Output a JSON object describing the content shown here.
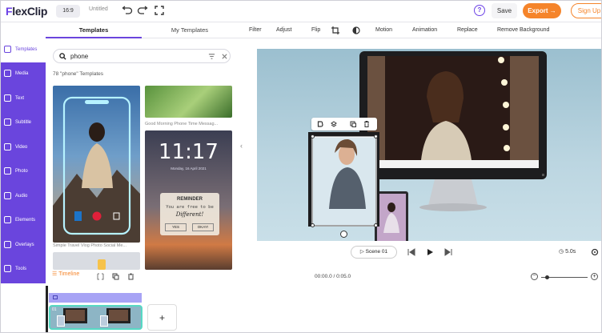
{
  "app": {
    "logo_mark": "F",
    "logo_text": "lexClip",
    "ratio": "16:9",
    "doc_title": "Untitled"
  },
  "header": {
    "save": "Save",
    "export": "Export →",
    "signup": "Sign Up"
  },
  "sidebar": {
    "items": [
      "Templates",
      "Media",
      "Text",
      "Subtitle",
      "Video",
      "Photo",
      "Audio",
      "Elements",
      "Overlays",
      "Tools"
    ],
    "active": "Templates"
  },
  "panel": {
    "tabs": [
      "Templates",
      "My Templates"
    ],
    "search": {
      "value": "phone"
    },
    "count": "78 \"phone\" Templates",
    "cards": {
      "travel_caption": "Simple Travel Vlog Photo Social Me...",
      "morning_caption": "Good Morning Phone Time Messag...",
      "clock_time": "11:17",
      "clock_sub": "Monday, 16 April 2021",
      "reminder_title": "REMINDER",
      "reminder_line1": "You are free to be",
      "reminder_line2": "Different!",
      "reminder_yes": "YES",
      "reminder_ok": "OKAY!"
    }
  },
  "toolbar": [
    "Filter",
    "Adjust",
    "Flip",
    "Motion",
    "Animation",
    "Replace",
    "Remove Background"
  ],
  "player": {
    "scene": "Scene 01",
    "duration": "5.0s"
  },
  "timeline": {
    "label": "Timeline",
    "timecode": "00:00.0 / 0:05.0",
    "clip_index": "01",
    "add": "+"
  },
  "colors": {
    "accent": "#6a45dd",
    "orange": "#f5842a",
    "teal": "#57d9c4"
  }
}
